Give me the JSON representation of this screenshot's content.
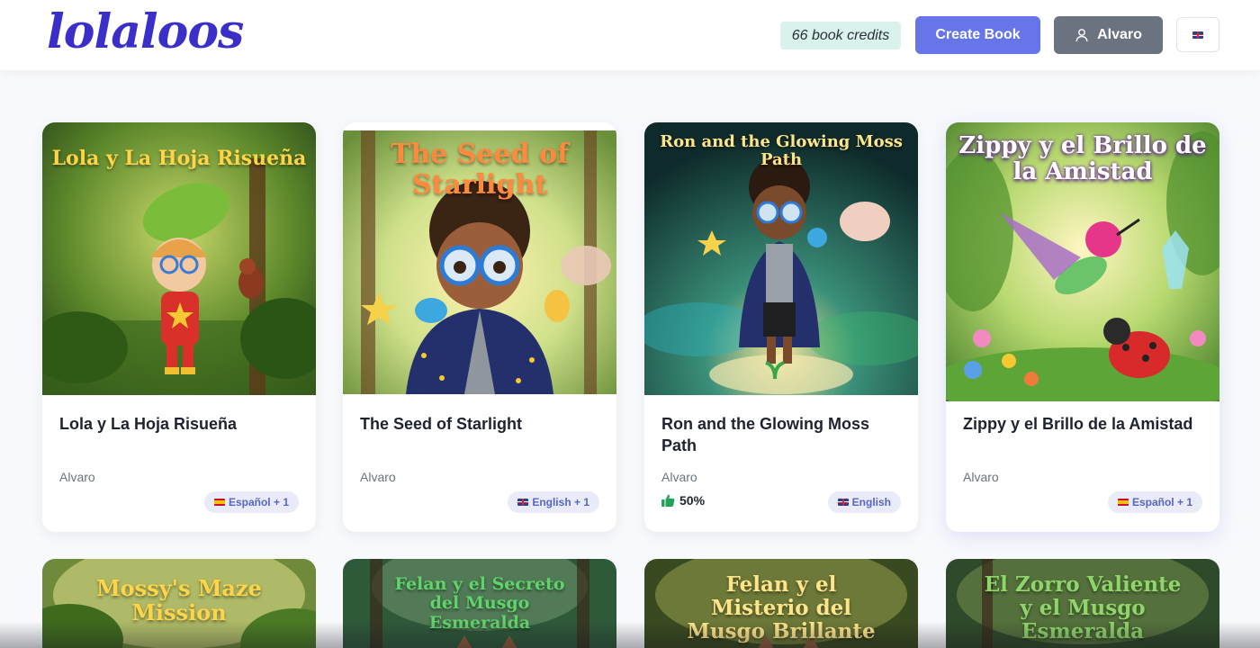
{
  "header": {
    "logo": "lolaloos",
    "credits": "66 book credits",
    "create_label": "Create Book",
    "user_label": "Alvaro",
    "user_icon": "user-icon",
    "lang_flag": "uk-flag-icon"
  },
  "books": [
    {
      "cover_title": "Lola y La Hoja Risueña",
      "title": "Lola y La Hoja Risueña",
      "author": "Alvaro",
      "language": "Español + 1",
      "flag": "es"
    },
    {
      "cover_title": "The Seed of Starlight",
      "title": "The Seed of Starlight",
      "author": "Alvaro",
      "language": "English + 1",
      "flag": "uk"
    },
    {
      "cover_title": "Ron and the Glowing Moss Path",
      "title": "Ron and the Glowing Moss Path",
      "author": "Alvaro",
      "rating": "50%",
      "language": "English",
      "flag": "uk"
    },
    {
      "cover_title": "Zippy y el Brillo de la Amistad",
      "title": "Zippy y el Brillo de la Amistad",
      "author": "Alvaro",
      "language": "Español + 1",
      "flag": "es"
    }
  ],
  "next_row": [
    {
      "cover_title": "Mossy's Maze Mission"
    },
    {
      "cover_title": "Felan y el Secreto del Musgo Esmeralda"
    },
    {
      "cover_title": "Felan y el Misterio del Musgo Brillante"
    },
    {
      "cover_title": "El Zorro Valiente y el Musgo Esmeralda"
    }
  ],
  "colors": {
    "brand": "#3b2fc9",
    "create_button": "#6676e8",
    "user_button": "#6b7280",
    "credits_bg": "#d9f2ec",
    "badge_bg": "#e9ecf8",
    "rating_icon": "#22a35a"
  }
}
